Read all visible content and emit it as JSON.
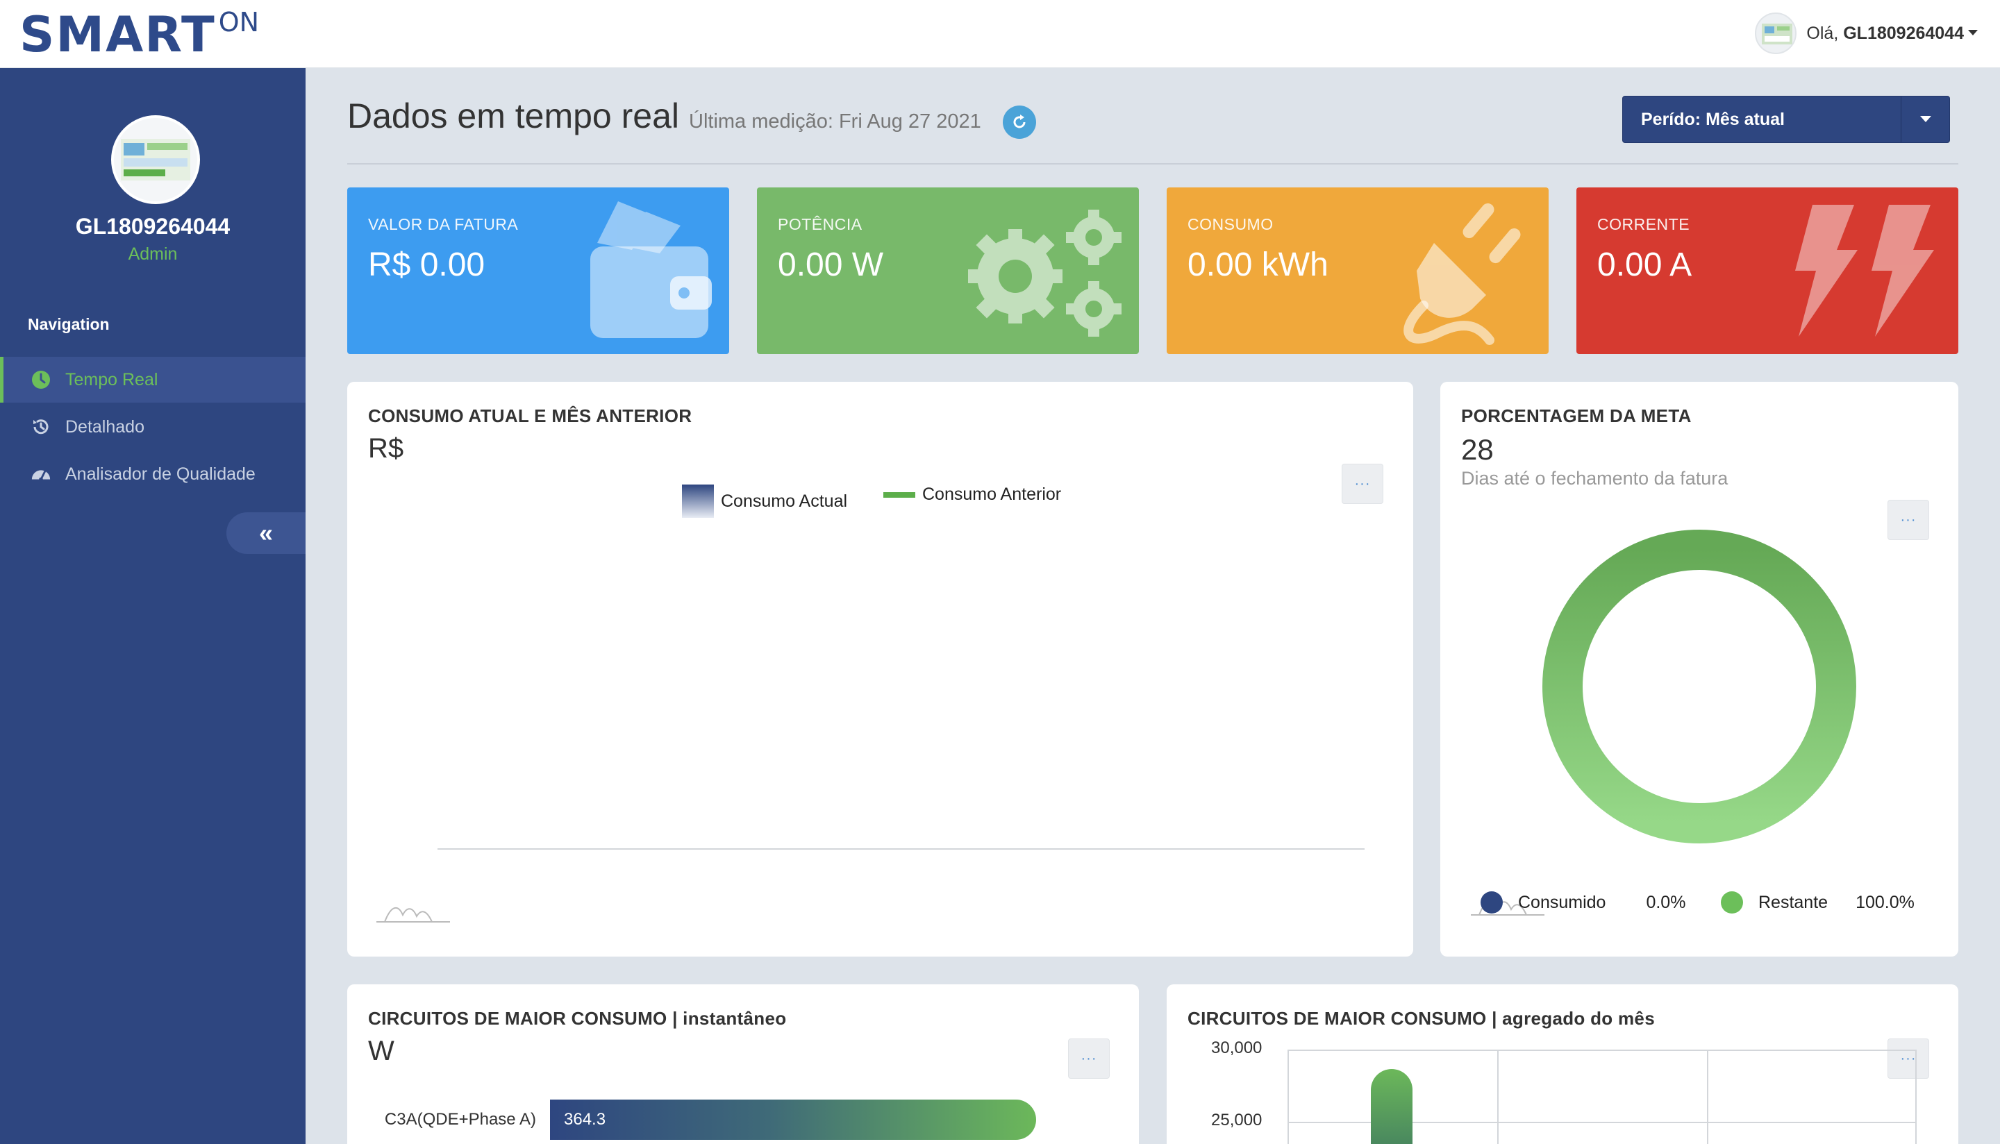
{
  "topbar": {
    "logo_main": "SMART",
    "logo_sup": "ON",
    "greeting_prefix": "Olá,",
    "username": "GL1809264044"
  },
  "sidebar": {
    "username": "GL1809264044",
    "role": "Admin",
    "nav_title": "Navigation",
    "items": [
      {
        "label": "Tempo Real",
        "icon": "clock-icon",
        "active": true
      },
      {
        "label": "Detalhado",
        "icon": "history-icon",
        "active": false
      },
      {
        "label": "Analisador de Qualidade",
        "icon": "gauge-icon",
        "active": false
      }
    ],
    "collapse_symbol": "«"
  },
  "header": {
    "title": "Dados em tempo real",
    "last_measure": "Última medição: Fri Aug 27 2021",
    "period": "Perído: Mês atual"
  },
  "kpis": [
    {
      "label": "VALOR DA FATURA",
      "value": "R$ 0.00",
      "color": "#3d9cf0",
      "icon": "wallet-icon"
    },
    {
      "label": "POTÊNCIA",
      "value": "0.00 W",
      "color": "#78b96a",
      "icon": "gears-icon"
    },
    {
      "label": "CONSUMO",
      "value": "0.00 kWh",
      "color": "#f0a83b",
      "icon": "plug-icon"
    },
    {
      "label": "CORRENTE",
      "value": "0.00 A",
      "color": "#d63a30",
      "icon": "lightning-icon"
    }
  ],
  "consumption_panel": {
    "title": "CONSUMO ATUAL E MÊS ANTERIOR",
    "unit": "R$",
    "menu": "···",
    "legend": [
      {
        "name": "Consumo Actual",
        "color": "#2e4680"
      },
      {
        "name": "Consumo Anterior",
        "color": "#5cae4a"
      }
    ]
  },
  "goal_panel": {
    "title": "PORCENTAGEM DA META",
    "days": "28",
    "days_label": "Dias até o fechamento da fatura",
    "menu": "···",
    "legend": [
      {
        "name": "Consumido",
        "value": "0.0%",
        "color": "#2e4680"
      },
      {
        "name": "Restante",
        "value": "100.0%",
        "color": "#6cbf5a"
      }
    ]
  },
  "circuits_instant": {
    "title": "CIRCUITOS DE MAIOR CONSUMO | instantâneo",
    "unit": "W",
    "menu": "···",
    "bars": [
      {
        "label": "C3A(QDE+Phase A)",
        "value": "364.3"
      }
    ]
  },
  "circuits_month": {
    "title": "CIRCUITOS DE MAIOR CONSUMO | agregado do mês",
    "menu": "···",
    "y_ticks": [
      "30,000",
      "25,000"
    ]
  },
  "chart_data": [
    {
      "type": "pie",
      "labels": [
        "Consumido",
        "Restante"
      ],
      "values": [
        0.0,
        100.0
      ]
    },
    {
      "type": "bar",
      "categories": [
        "C3A(QDE+Phase A)"
      ],
      "values": [
        364.3
      ],
      "ylabel": "W"
    }
  ]
}
